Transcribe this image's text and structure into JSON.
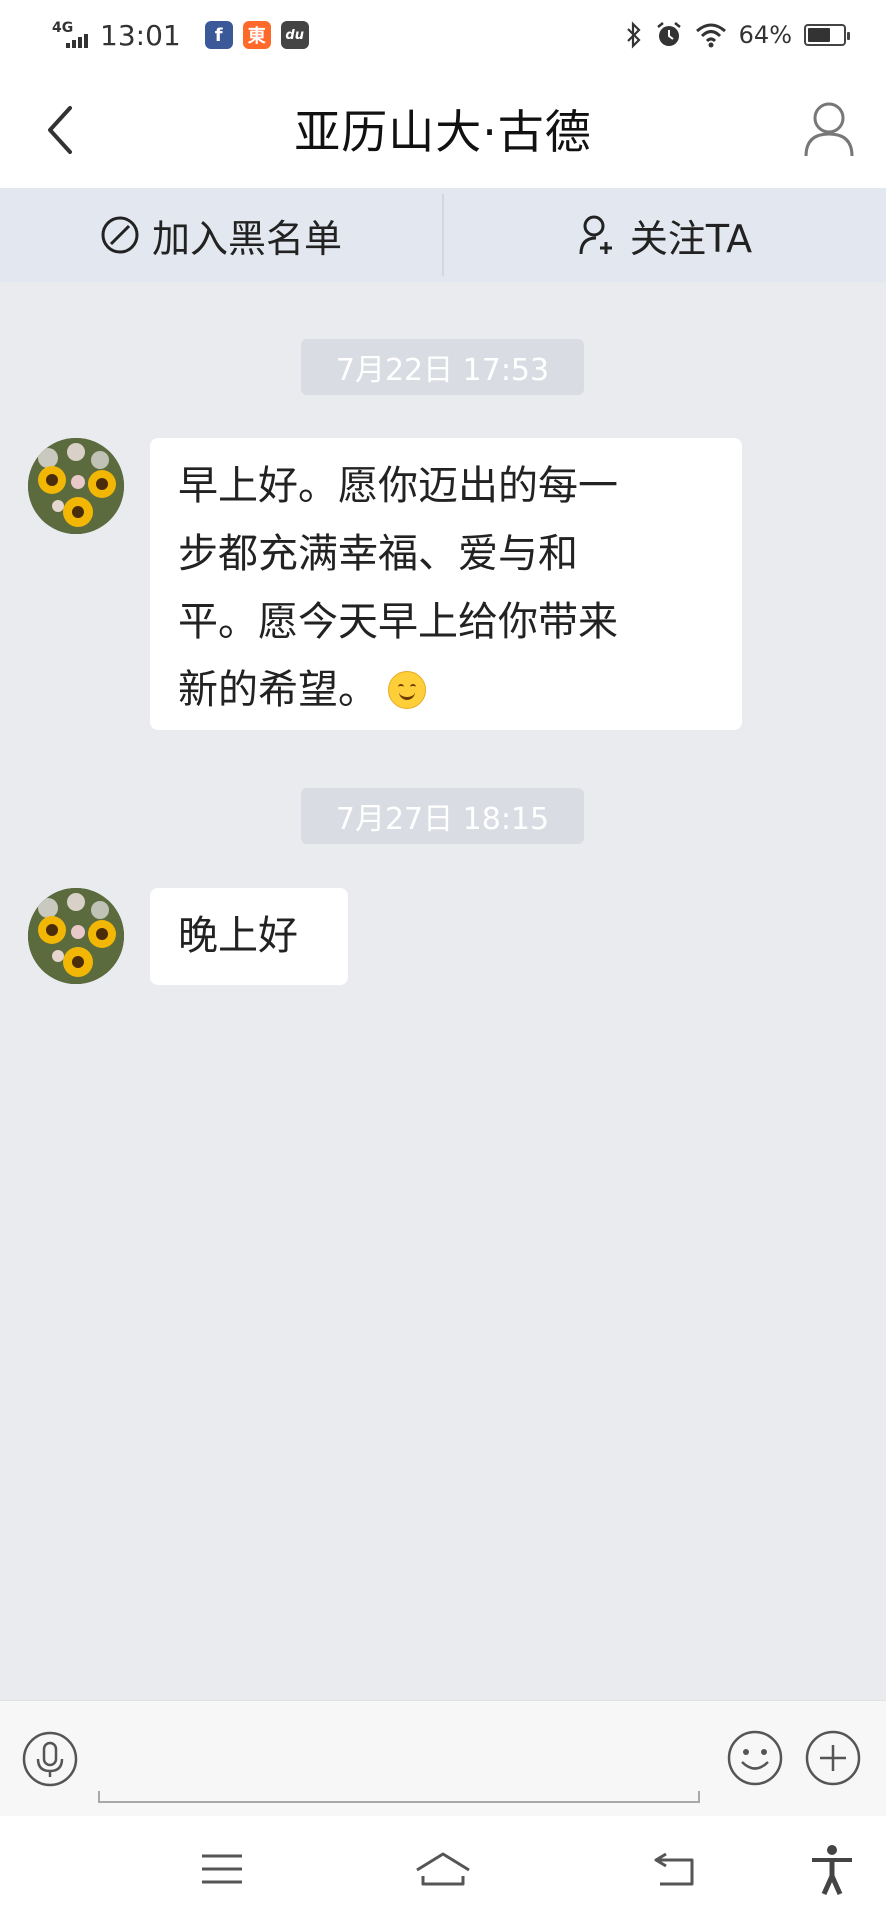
{
  "status_bar": {
    "network": "4G",
    "time": "13:01",
    "app_icons": [
      {
        "name": "facebook-icon",
        "glyph": "f",
        "color": "#3b5998"
      },
      {
        "name": "taobao-icon",
        "glyph": "東",
        "color": "#ff6a2b"
      },
      {
        "name": "cat-app-icon",
        "glyph": "du",
        "color": "#444444"
      }
    ],
    "battery": "64%",
    "battery_level": 0.64
  },
  "header": {
    "title": "亚历山大·古德",
    "back_icon": "chevron-left-icon",
    "profile_icon": "user-icon"
  },
  "actions": [
    {
      "label": "加入黑名单",
      "icon": "block-icon"
    },
    {
      "label": "关注TA",
      "icon": "add-user-icon"
    }
  ],
  "messages": [
    {
      "timestamp": "7月22日 17:53",
      "lines": [
        "早上好。愿你迈出的每一",
        "步都充满幸福、爱与和",
        "平。愿今天早上给你带来",
        "新的希望。"
      ],
      "emoji": "smile-emoji"
    },
    {
      "timestamp": "7月27日 18:15",
      "lines": [
        "晚上好"
      ]
    }
  ],
  "input": {
    "placeholder": "",
    "value": ""
  },
  "colors": {
    "background": "#e9ebef",
    "action_bar": "#e3e7f0",
    "timestamp_bg": "#d9dce2"
  }
}
